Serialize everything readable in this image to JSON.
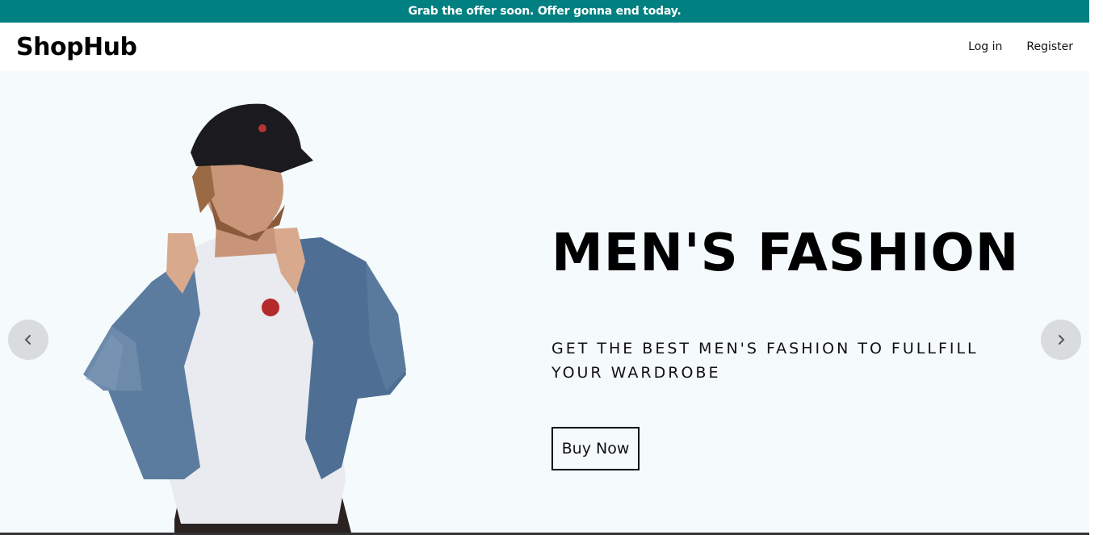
{
  "announcement": {
    "text": "Grab the offer soon. Offer gonna end today."
  },
  "navbar": {
    "logo": "ShopHub",
    "links": [
      {
        "label": "Log in"
      },
      {
        "label": "Register"
      }
    ]
  },
  "hero": {
    "title": "MEN'S FASHION",
    "description": "GET THE BEST MEN'S FASHION TO FULLFILL YOUR WARDROBE",
    "button_label": "Buy Now",
    "background": "#f5fafd"
  },
  "icons": {
    "prev": "chevron-left-icon",
    "next": "chevron-right-icon"
  },
  "colors": {
    "announcement_bg": "#008080",
    "arrow_bg": "#d9dcde"
  }
}
